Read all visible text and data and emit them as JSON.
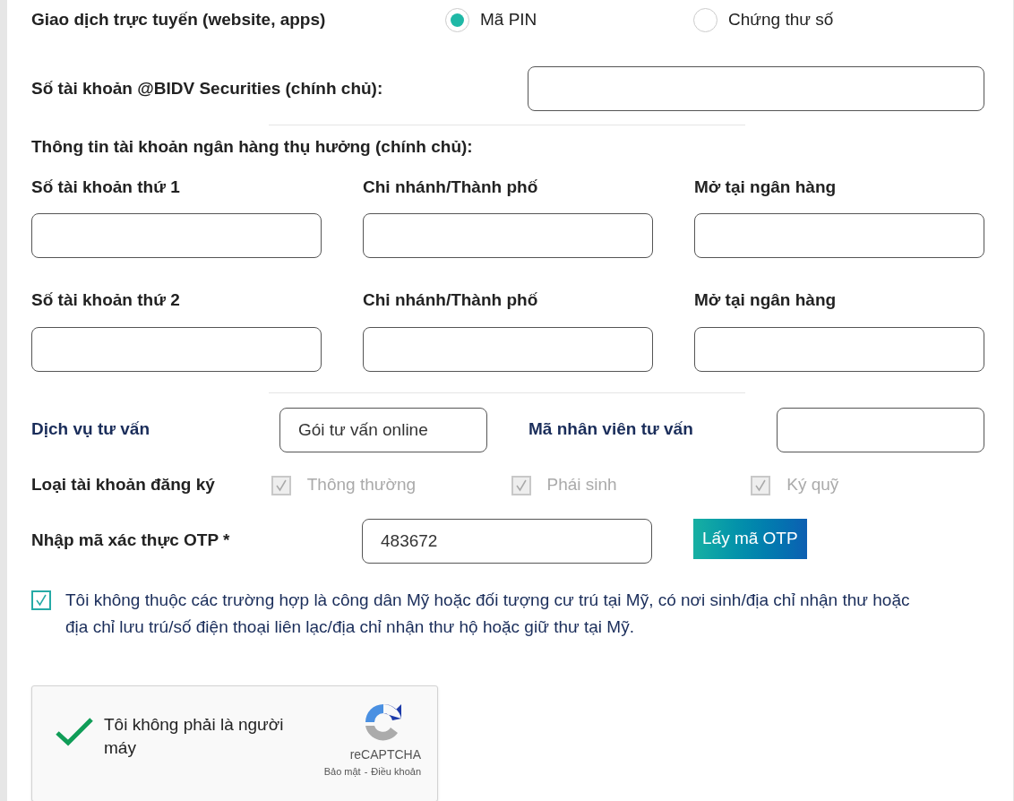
{
  "transaction": {
    "label": "Giao dịch trực tuyến (website, apps)",
    "options": [
      {
        "label": "Mã PIN",
        "selected": true
      },
      {
        "label": "Chứng thư số",
        "selected": false
      }
    ]
  },
  "securities_account": {
    "label": "Số tài khoản @BIDV Securities (chính chủ):"
  },
  "bank_section": {
    "title": "Thông tin tài khoản ngân hàng thụ hưởng (chính chủ):",
    "rows": [
      {
        "fields": [
          {
            "label": "Số tài khoản thứ 1"
          },
          {
            "label": "Chi nhánh/Thành phố"
          },
          {
            "label": "Mở tại ngân hàng"
          }
        ]
      },
      {
        "fields": [
          {
            "label": "Số tài khoản thứ 2"
          },
          {
            "label": "Chi nhánh/Thành phố"
          },
          {
            "label": "Mở tại ngân hàng"
          }
        ]
      }
    ]
  },
  "advisory": {
    "label": "Dịch vụ tư vấn",
    "value": "Gói tư vấn online",
    "staff_label": "Mã nhân viên tư vấn"
  },
  "account_types": {
    "label": "Loại tài khoản đăng ký",
    "options": [
      {
        "label": "Thông thường",
        "checked": true,
        "disabled": true
      },
      {
        "label": "Phái sinh",
        "checked": true,
        "disabled": true
      },
      {
        "label": "Ký quỹ",
        "checked": true,
        "disabled": true
      }
    ]
  },
  "otp": {
    "label": "Nhập mã xác thực OTP *",
    "value": "483672",
    "button": "Lấy mã OTP"
  },
  "consent": {
    "checked": true,
    "text": "Tôi không thuộc các trường hợp là công dân Mỹ hoặc đối tượng cư trú tại Mỹ, có nơi sinh/địa chỉ nhận thư hoặc địa chỉ lưu trú/số điện thoại liên lạc/địa chỉ nhận thư hộ hoặc giữ thư tại Mỹ."
  },
  "recaptcha": {
    "checked": true,
    "label": "Tôi không phải là người máy",
    "brand": "reCAPTCHA",
    "privacy": "Bảo mật",
    "separator": "-",
    "terms": "Điều khoản"
  }
}
